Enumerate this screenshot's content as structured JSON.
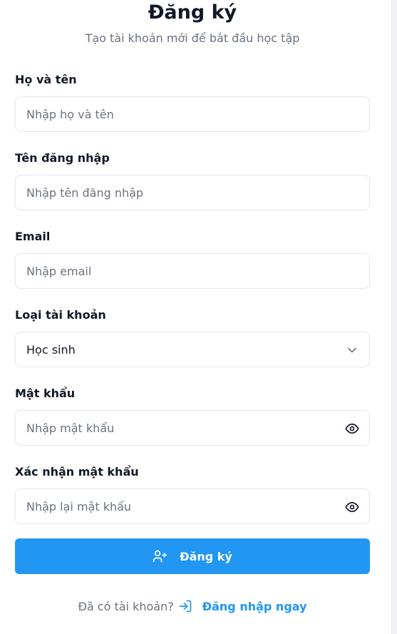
{
  "header": {
    "title": "Đăng ký",
    "subtitle": "Tạo tài khoản mới để bắt đầu học tập"
  },
  "form": {
    "fullname": {
      "label": "Họ và tên",
      "placeholder": "Nhập họ và tên"
    },
    "username": {
      "label": "Tên đăng nhập",
      "placeholder": "Nhập tên đăng nhập"
    },
    "email": {
      "label": "Email",
      "placeholder": "Nhập email"
    },
    "account_type": {
      "label": "Loại tài khoản",
      "value": "Học sinh"
    },
    "password": {
      "label": "Mật khẩu",
      "placeholder": "Nhập mật khẩu",
      "icon": "eye-icon"
    },
    "confirm_password": {
      "label": "Xác nhận mật khẩu",
      "placeholder": "Nhập lại mật khẩu",
      "icon": "eye-icon"
    },
    "submit_label": "Đăng ký"
  },
  "footer": {
    "question": "Đã có tài khoản?",
    "login_link": "Đăng nhập ngay"
  },
  "colors": {
    "primary": "#2196f3",
    "text": "#111827",
    "muted": "#6b7280",
    "border": "#e3e5e8"
  }
}
